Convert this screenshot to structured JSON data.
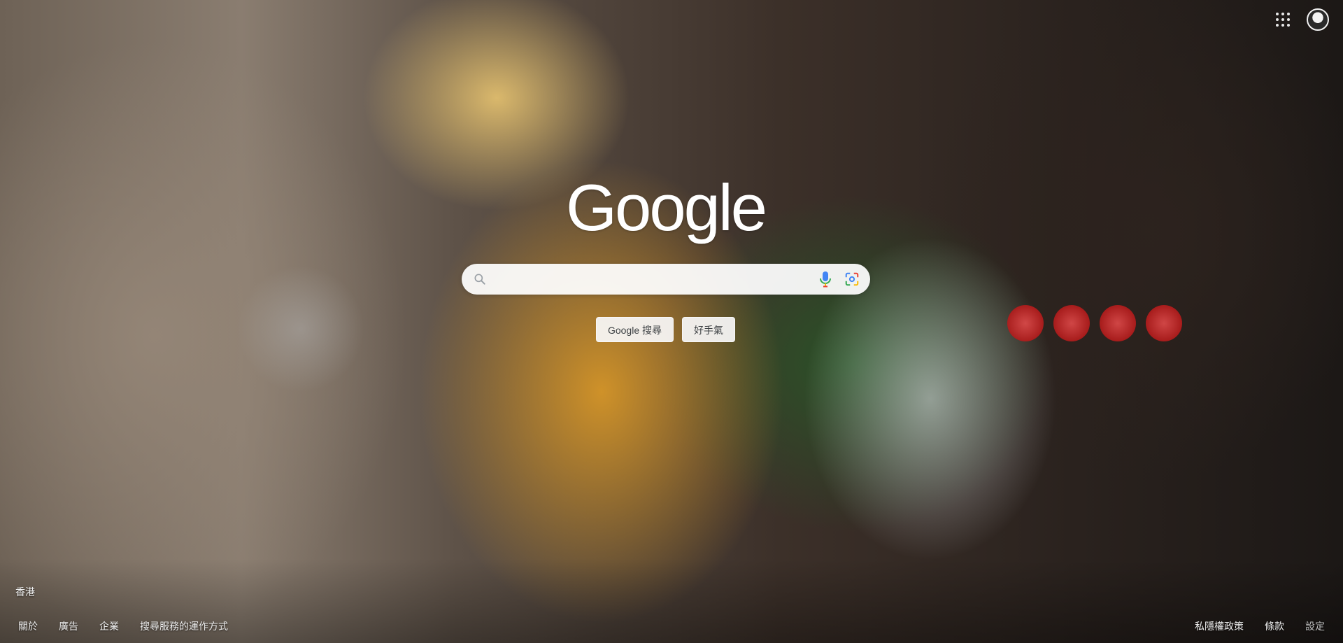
{
  "logo": {
    "text": "Google"
  },
  "search": {
    "value": "",
    "placeholder": ""
  },
  "buttons": {
    "search": "Google 搜尋",
    "lucky": "好手氣"
  },
  "footer": {
    "location": "香港",
    "left_links": [
      "關於",
      "廣告",
      "企業",
      "搜尋服務的運作方式"
    ],
    "right_links": [
      "私隱權政策",
      "條款",
      "設定"
    ]
  },
  "icons": {
    "search": "search-icon",
    "voice": "microphone-icon",
    "lens": "camera-lens-icon",
    "apps": "apps-grid-icon",
    "account": "avatar"
  },
  "colors": {
    "mic_blue": "#4285f4",
    "mic_red": "#ea4335",
    "mic_yellow": "#fbbc05",
    "mic_green": "#34a853"
  }
}
